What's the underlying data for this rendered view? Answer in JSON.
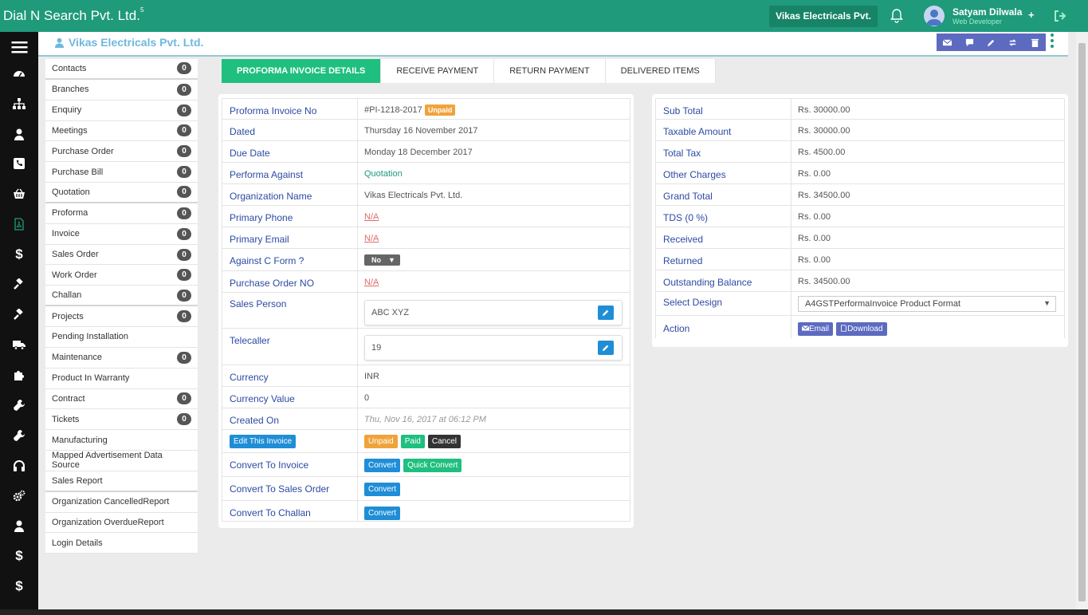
{
  "app": {
    "brand": "Dial N Search Pvt. Ltd.",
    "brand_sup": "5",
    "org_button": "Vikas Electricals Pvt.",
    "user_name": "Satyam Dilwala",
    "user_role": "Web Developer",
    "user_plus": "+"
  },
  "header": {
    "org_title": "Vikas Electricals Pvt. Ltd."
  },
  "rail": {
    "icons": [
      "menu-icon",
      "dashboard-icon",
      "sitemap-icon",
      "user-icon",
      "phone-icon",
      "basket-icon",
      "pdf-file-icon",
      "dollar-icon",
      "gavel-icon",
      "gavel-icon",
      "truck-icon",
      "puzzle-icon",
      "wrench-icon",
      "wrench-icon",
      "headphones-icon",
      "cogs-icon",
      "user-icon",
      "dollar-icon",
      "dollar-icon"
    ],
    "dollar": "$"
  },
  "sidemenu": [
    {
      "label": "Contacts",
      "count": "0"
    },
    {
      "label": "Branches",
      "count": "0"
    },
    {
      "label": "Enquiry",
      "count": "0"
    },
    {
      "label": "Meetings",
      "count": "0"
    },
    {
      "label": "Purchase Order",
      "count": "0"
    },
    {
      "label": "Purchase Bill",
      "count": "0"
    },
    {
      "label": "Quotation",
      "count": "0"
    },
    {
      "label": "Proforma",
      "count": "0"
    },
    {
      "label": "Invoice",
      "count": "0"
    },
    {
      "label": "Sales Order",
      "count": "0"
    },
    {
      "label": "Work Order",
      "count": "0"
    },
    {
      "label": "Challan",
      "count": "0"
    },
    {
      "label": "Projects",
      "count": "0"
    },
    {
      "label": "Pending Installation",
      "count": ""
    },
    {
      "label": "Maintenance",
      "count": "0"
    },
    {
      "label": "Product In Warranty",
      "count": ""
    },
    {
      "label": "Contract",
      "count": "0"
    },
    {
      "label": "Tickets",
      "count": "0"
    },
    {
      "label": "Manufacturing",
      "count": ""
    },
    {
      "label": "Mapped Advertisement Data Source",
      "count": ""
    },
    {
      "label": "Sales Report",
      "count": ""
    },
    {
      "label": "Organization CancelledReport",
      "count": ""
    },
    {
      "label": "Organization OverdueReport",
      "count": ""
    },
    {
      "label": "Login Details",
      "count": ""
    }
  ],
  "tabs": [
    "PROFORMA INVOICE DETAILS",
    "RECEIVE PAYMENT",
    "RETURN PAYMENT",
    "DELIVERED ITEMS"
  ],
  "details": {
    "invoice_no_label": "Proforma Invoice No",
    "invoice_no": "#PI-1218-2017",
    "invoice_status": "Unpaid",
    "dated_label": "Dated",
    "dated": "Thursday 16 November 2017",
    "due_label": "Due Date",
    "due": "Monday 18 December 2017",
    "against_label": "Performa Against",
    "against": "Quotation",
    "org_label": "Organization Name",
    "org": "Vikas Electricals Pvt. Ltd.",
    "phone_label": "Primary Phone",
    "phone": "N/A",
    "email_label": "Primary Email",
    "email": "N/A",
    "cform_label": "Against C Form ?",
    "cform": "No",
    "po_label": "Purchase Order NO",
    "po": "N/A",
    "sales_label": "Sales Person",
    "sales": "ABC XYZ",
    "tele_label": "Telecaller",
    "tele": "19",
    "currency_label": "Currency",
    "currency": "INR",
    "currency_value_label": "Currency Value",
    "currency_value": "0",
    "created_label": "Created On",
    "created": "Thu, Nov 16, 2017 at 06:12 PM",
    "edit_btn": "Edit This Invoice",
    "status_unpaid": "Unpaid",
    "status_paid": "Paid",
    "status_cancel": "Cancel",
    "conv_invoice_label": "Convert To Invoice",
    "convert": "Convert",
    "quick_convert": "Quick Convert",
    "conv_so_label": "Convert To Sales Order",
    "conv_challan_label": "Convert To Challan"
  },
  "summary": {
    "subtotal_label": "Sub Total",
    "subtotal": "Rs. 30000.00",
    "taxable_label": "Taxable Amount",
    "taxable": "Rs. 30000.00",
    "tax_label": "Total Tax",
    "tax": "Rs. 4500.00",
    "other_label": "Other Charges",
    "other": "Rs. 0.00",
    "grand_label": "Grand Total",
    "grand": "Rs. 34500.00",
    "tds_label": "TDS (0 %)",
    "tds": "Rs. 0.00",
    "received_label": "Received",
    "received": "Rs. 0.00",
    "returned_label": "Returned",
    "returned": "Rs. 0.00",
    "outstanding_label": "Outstanding Balance",
    "outstanding": "Rs. 34500.00",
    "design_label": "Select Design",
    "design": "A4GSTPerformaInvoice Product Format",
    "action_label": "Action",
    "email_btn": "Email",
    "download_btn": "Download"
  },
  "colors": {
    "brand": "#1f9a7b",
    "accent_green": "#1fbf7f",
    "link_blue": "#2c4aa3",
    "indigo": "#5c6bc0"
  }
}
